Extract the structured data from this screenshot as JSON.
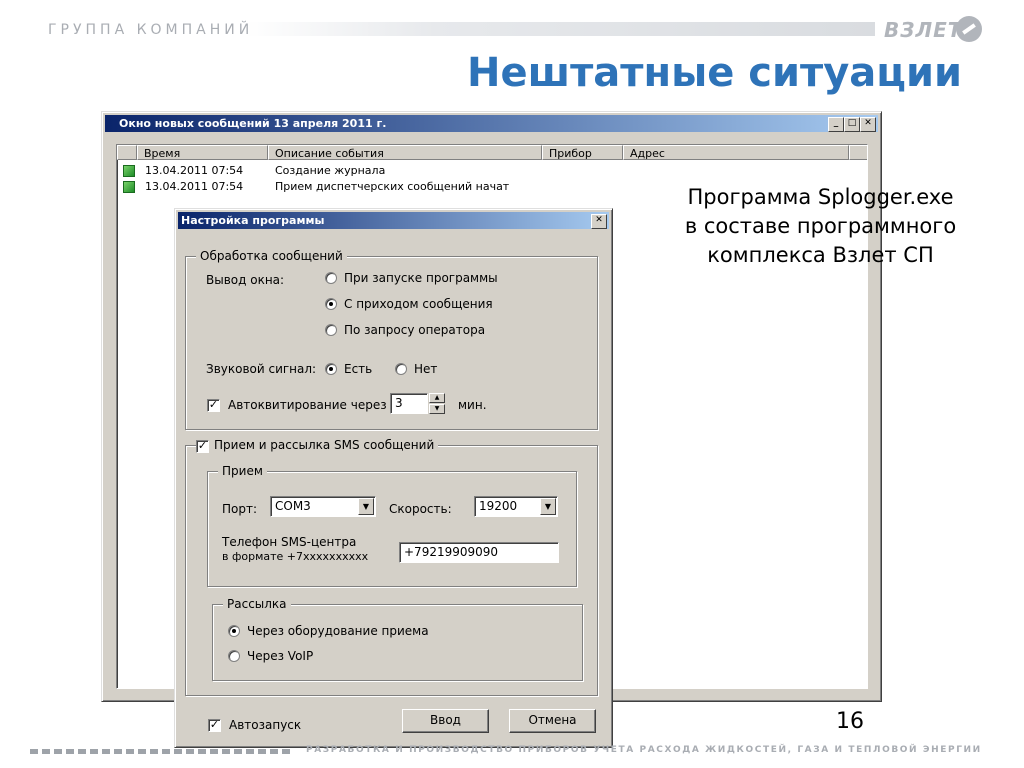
{
  "slide": {
    "header_text": "ГРУППА КОМПАНИЙ",
    "brand": "ВЗЛЕТ",
    "title": "Нештатные ситуации",
    "caption_lines": [
      "Программа Splogger.exe",
      "в составе программного",
      "комплекса Взлет СП"
    ],
    "page_number": "16",
    "footer_text": "РАЗРАБОТКА И ПРОИЗВОДСТВО ПРИБОРОВ УЧЕТА РАСХОДА ЖИДКОСТЕЙ, ГАЗА И ТЕПЛОВОЙ ЭНЕРГИИ"
  },
  "msg_window": {
    "title": "Окно новых сообщений 13 апреля 2011 г.",
    "columns": [
      "Время",
      "Описание события",
      "Прибор",
      "Адрес"
    ],
    "rows": [
      {
        "time": "13.04.2011 07:54",
        "description": "Создание журнала",
        "status_icon": "green-status-icon"
      },
      {
        "time": "13.04.2011 07:54",
        "description": "Прием диспетчерских сообщений начат",
        "status_icon": "green-status-icon"
      }
    ]
  },
  "settings": {
    "title": "Настройка программы",
    "msg_group": "Обработка сообщений",
    "window_output_label": "Вывод окна:",
    "window_options": [
      "При запуске программы",
      "С приходом сообщения",
      "По запросу оператора"
    ],
    "window_selected": "С приходом сообщения",
    "sound_label": "Звуковой сигнал:",
    "sound_yes": "Есть",
    "sound_no": "Нет",
    "sound_selected": "Есть",
    "autoack_label": "Автоквитирование через",
    "autoack_checked": true,
    "autoack_value": "3",
    "autoack_unit": "мин.",
    "sms_group": "Прием и рассылка SMS сообщений",
    "sms_checked": true,
    "receive_group": "Прием",
    "port_label": "Порт:",
    "port_value": "COM3",
    "speed_label": "Скорость:",
    "speed_value": "19200",
    "phone_label_line1": "Телефон SMS-центра",
    "phone_label_line2": "в формате +7xxxxxxxxxx",
    "phone_value": "+79219909090",
    "send_group": "Рассылка",
    "send_options": [
      "Через оборудование приема",
      "Через VoIP"
    ],
    "send_selected": "Через оборудование приема",
    "autostart_label": "Автозапуск",
    "autostart_checked": true,
    "ok_label": "Ввод",
    "cancel_label": "Отмена"
  }
}
